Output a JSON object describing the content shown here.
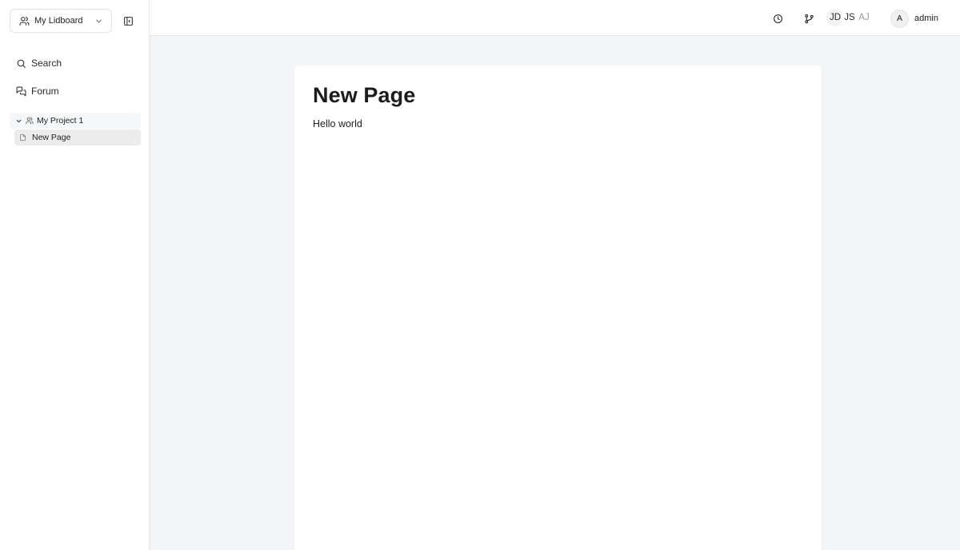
{
  "sidebar": {
    "workspace": {
      "label": "My Lidboard",
      "icon": "users-icon",
      "chevron": "chevron-down-icon"
    },
    "collapse_icon": "sidebar-toggle-icon",
    "nav": [
      {
        "label": "Search",
        "icon": "search-icon"
      },
      {
        "label": "Forum",
        "icon": "chat-bubbles-icon"
      }
    ],
    "tree": {
      "project": {
        "label": "My Project 1",
        "icon": "users-icon",
        "expanded": true
      },
      "pages": [
        {
          "label": "New Page",
          "icon": "file-icon",
          "selected": true
        }
      ]
    }
  },
  "header": {
    "history_icon": "clock-icon",
    "branch_icon": "git-branch-icon",
    "collaborators": [
      "JD",
      "JS",
      "AJ"
    ],
    "user": {
      "initial": "A",
      "name": "admin"
    }
  },
  "document": {
    "title": "New Page",
    "body": "Hello world"
  },
  "colors": {
    "background": "#f4f5f6",
    "surface": "#ffffff",
    "selected_item": "#ececec",
    "text": "#1f1f1f",
    "muted": "#9a9a9a"
  }
}
